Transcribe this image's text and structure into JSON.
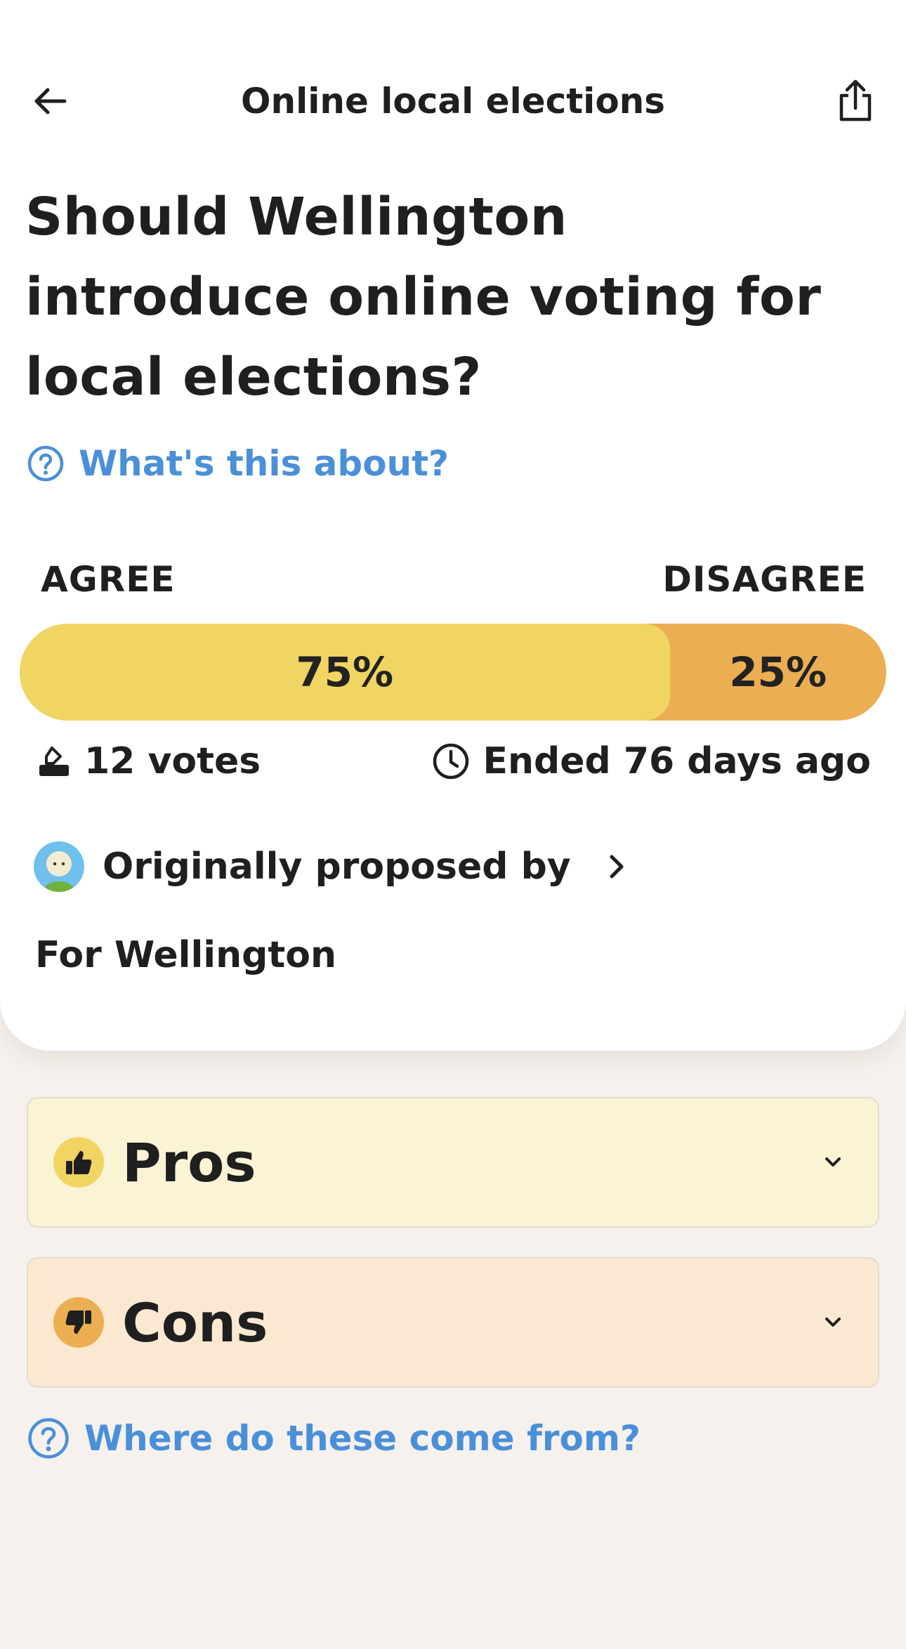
{
  "header": {
    "title": "Online local elections",
    "back_icon": "arrow-left-icon",
    "share_icon": "share-icon"
  },
  "question": "Should Wellington introduce online voting for local elections?",
  "help_link": "What's this about?",
  "vote": {
    "agree_label": "AGREE",
    "disagree_label": "DISAGREE",
    "agree_fraction": 0.75,
    "agree_percent": "75%",
    "disagree_percent": "25%",
    "votes_text": "12 votes",
    "ended_text": "Ended 76 days ago"
  },
  "proposal": {
    "proposed_by_label": "Originally proposed by",
    "proposer_name": "For Wellington"
  },
  "sections": {
    "pros_label": "Pros",
    "cons_label": "Cons"
  },
  "source_link": "Where do these come from?",
  "colors": {
    "agree": "#f1d563",
    "disagree": "#ecae52",
    "link": "#4a90d9",
    "pros_bg": "#faf3d4",
    "cons_bg": "#fae8d1",
    "page_bg": "#f6f1ed"
  }
}
